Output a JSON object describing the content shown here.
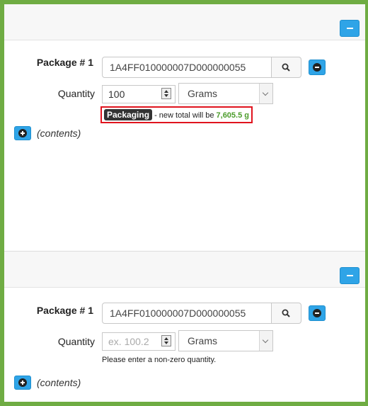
{
  "packages": [
    {
      "package_label": "Package # 1",
      "tag_value": "1A4FF010000007D000000055",
      "quantity_label": "Quantity",
      "quantity_value": "100",
      "quantity_placeholder": "",
      "unit": "Grams",
      "notice": {
        "badge": "Packaging",
        "text": " - new total will be ",
        "total": "7,605.5 g"
      },
      "contents_label": "(contents)"
    },
    {
      "package_label": "Package # 1",
      "tag_value": "1A4FF010000007D000000055",
      "quantity_label": "Quantity",
      "quantity_value": "",
      "quantity_placeholder": "ex. 100.2",
      "unit": "Grams",
      "validation_message": "Please enter a non-zero quantity.",
      "contents_label": "(contents)"
    }
  ],
  "colors": {
    "frame": "#6fac43",
    "primary_button": "#2fa4e7",
    "notice_border": "#e0141e",
    "total_text": "#4b9c2b"
  },
  "icons": {
    "collapse": "minus-icon",
    "search": "search-icon",
    "remove": "minus-circle-icon",
    "add": "plus-circle-icon"
  }
}
